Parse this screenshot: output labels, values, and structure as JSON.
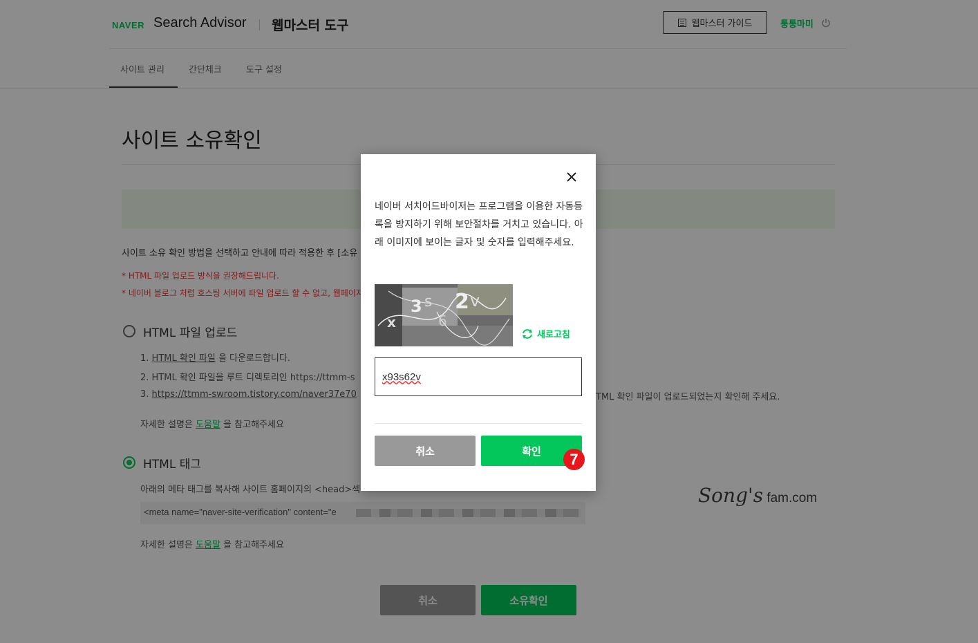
{
  "header": {
    "brand_naver": "NAVER",
    "brand_product": "Search Advisor",
    "brand_tool": "웹마스터 도구",
    "guide_button": "웹마스터 가이드",
    "user_name": "퉁퉁마미"
  },
  "tabs": [
    {
      "label": "사이트 관리",
      "active": true
    },
    {
      "label": "간단체크",
      "active": false
    },
    {
      "label": "도구 설정",
      "active": false
    }
  ],
  "page": {
    "title": "사이트 소유확인",
    "description": "사이트 소유 확인 방법을 선택하고 안내에 따라 적용한 후 [소유",
    "warnings": [
      "* HTML 파일 업로드 방식을 권장해드립니다.",
      "* 네이버 블로그 처럼 호스팅 서버에 파일 업로드 할 수 없고, 웹페이지"
    ],
    "option_upload": {
      "label": "HTML 파일 업로드",
      "selected": false,
      "step1_link": "HTML 확인 파일",
      "step1_rest": " 을 다운로드합니다.",
      "step2": "2. HTML 확인 파일을 루트 디렉토리인 https://ttmm-s",
      "step3_link": "https://ttmm-swroom.tistory.com/naver37e70",
      "step3_rest": "TML 확인 파일이 업로드되었는지 확인해 주세요.",
      "help_prefix": "자세한 설명은 ",
      "help_link": "도움말",
      "help_suffix": " 을 참고해주세요"
    },
    "option_tag": {
      "label": "HTML 태그",
      "selected": true,
      "instruction": "아래의 메타 태그를 복사해 사이트 홈페이지의 <head>섹",
      "meta_tag": "<meta name=\"naver-site-verification\" content=\"e",
      "help_prefix": "자세한 설명은 ",
      "help_link": "도움말",
      "help_suffix": " 을 참고해주세요"
    },
    "cancel_button": "취소",
    "confirm_button": "소유확인",
    "watermark_script": "Song's",
    "watermark_text": " fam.com"
  },
  "modal": {
    "message": "네이버 서치어드바이저는 프로그램을 이용한 자동등록을 방지하기 위해 보안절차를 거치고 있습니다. 아래 이미지에 보이는 글자 및 숫자를 입력해주세요.",
    "refresh_label": "새로고침",
    "captcha_input_value": "x93s62v",
    "cancel_button": "취소",
    "confirm_button": "확인",
    "step_badge": "7"
  },
  "colors": {
    "accent_green": "#03c75a",
    "warning_red": "#ee3333",
    "badge_red": "#e8151b"
  }
}
